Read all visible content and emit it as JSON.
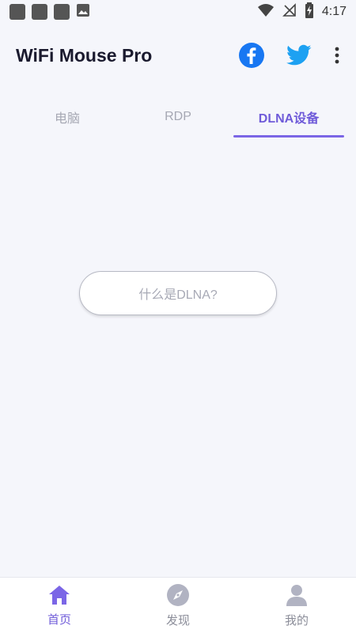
{
  "status_bar": {
    "time": "4:17",
    "icons": [
      "notification-icon",
      "notification-icon",
      "notification-icon",
      "image-icon",
      "wifi-icon",
      "no-signal-icon",
      "battery-charging-icon"
    ]
  },
  "app_bar": {
    "title": "WiFi Mouse Pro",
    "actions": [
      "facebook-icon",
      "twitter-icon",
      "more-vert-icon"
    ]
  },
  "tabs": [
    {
      "label": "电脑",
      "active": false
    },
    {
      "label": "RDP",
      "active": false
    },
    {
      "label": "DLNA设备",
      "active": true
    }
  ],
  "content": {
    "dlna_button_label": "什么是DLNA?"
  },
  "bottom_nav": [
    {
      "label": "首页",
      "icon": "home-icon",
      "active": true
    },
    {
      "label": "发现",
      "icon": "compass-icon",
      "active": false
    },
    {
      "label": "我的",
      "icon": "person-icon",
      "active": false
    }
  ],
  "colors": {
    "accent": "#6f5bd9",
    "background": "#f5f6fb",
    "facebook": "#1877f2",
    "twitter": "#1da1f2"
  }
}
